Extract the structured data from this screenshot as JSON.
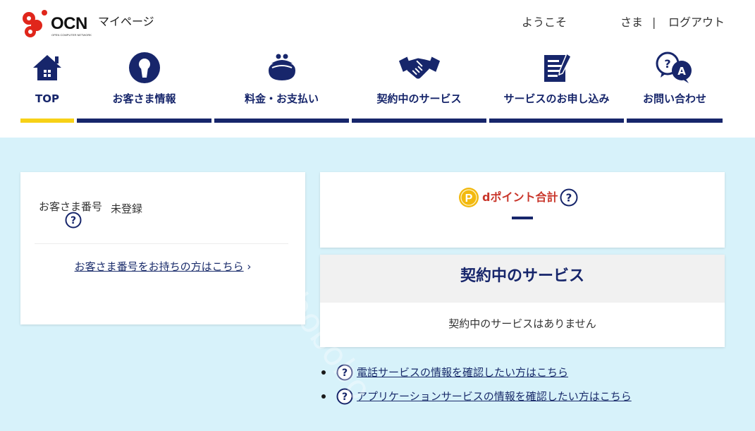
{
  "header": {
    "logo_text": "OCN",
    "logo_subtext": "OPEN COMPUTER NETWORK",
    "page_title": "マイページ",
    "welcome_prefix": "ようこそ",
    "welcome_suffix": "さま",
    "separator": "|",
    "logout_label": "ログアウト"
  },
  "nav": {
    "items": [
      {
        "label": "TOP",
        "icon": "home-icon",
        "active": true
      },
      {
        "label": "お客さま情報",
        "icon": "keyhole-icon",
        "active": false
      },
      {
        "label": "料金・お支払い",
        "icon": "coin-purse-icon",
        "active": false
      },
      {
        "label": "契約中のサービス",
        "icon": "handshake-icon",
        "active": false
      },
      {
        "label": "サービスのお申し込み",
        "icon": "document-pen-icon",
        "active": false
      },
      {
        "label": "お問い合わせ",
        "icon": "question-chat-icon",
        "active": false
      }
    ],
    "active_color": "#f7d117",
    "inactive_color": "#17266b"
  },
  "customer": {
    "number_label": "お客さま番号",
    "number_value": "未登録",
    "link_label": "お客さま番号をお持ちの方はこちら",
    "link_chevron": "›"
  },
  "points": {
    "coin_letter": "P",
    "title": "dポイント合計",
    "value_placeholder": "—"
  },
  "contract": {
    "title": "契約中のサービス",
    "empty_message": "契約中のサービスはありません"
  },
  "help_links": [
    {
      "label": "電話サービスの情報を確認したい方はこちら"
    },
    {
      "label": "アプリケーションサービスの情報を確認したい方はこちら"
    }
  ],
  "colors": {
    "brand_navy": "#17266b",
    "accent_red": "#c9362b",
    "page_background": "#d7f2fa",
    "logo_red": "#e0261b"
  },
  "watermark": "bobobo"
}
